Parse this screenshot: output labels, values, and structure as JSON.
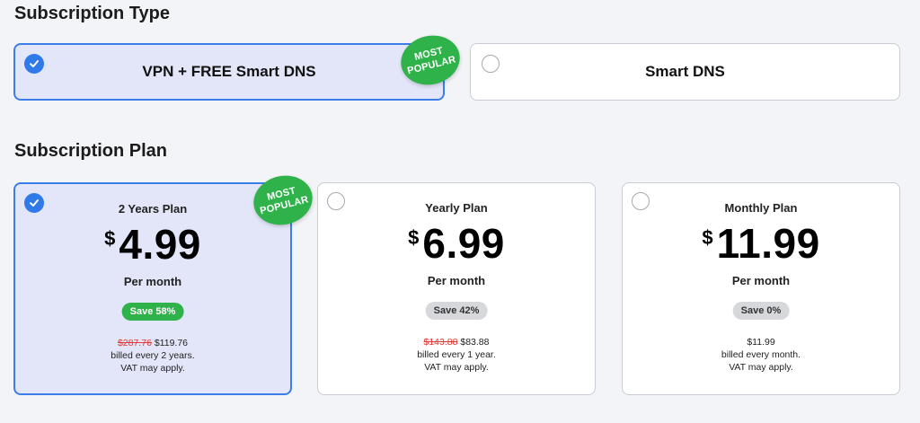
{
  "subscription_type": {
    "title": "Subscription Type",
    "options": [
      {
        "label": "VPN + FREE Smart DNS",
        "selected": true
      },
      {
        "label": "Smart DNS",
        "selected": false
      }
    ],
    "badge": {
      "line1": "MOST",
      "line2": "POPULAR"
    }
  },
  "subscription_plan": {
    "title": "Subscription Plan",
    "badge": {
      "line1": "MOST",
      "line2": "POPULAR"
    },
    "plans": [
      {
        "name": "2 Years Plan",
        "currency": "$",
        "price": "4.99",
        "per": "Per month",
        "save": "Save 58%",
        "old_price": "$287.76",
        "total": "$119.76",
        "billed": "billed every 2 years.",
        "vat": "VAT may apply.",
        "selected": true
      },
      {
        "name": "Yearly Plan",
        "currency": "$",
        "price": "6.99",
        "per": "Per month",
        "save": "Save 42%",
        "old_price": "$143.88",
        "total": "$83.88",
        "billed": "billed every 1 year.",
        "vat": "VAT may apply.",
        "selected": false
      },
      {
        "name": "Monthly Plan",
        "currency": "$",
        "price": "11.99",
        "per": "Per month",
        "save": "Save 0%",
        "old_price": "",
        "total": "$11.99",
        "billed": "billed every month.",
        "vat": "VAT may apply.",
        "selected": false
      }
    ]
  },
  "colors": {
    "accent": "#3b7de9",
    "selected_bg": "#e2e6f8",
    "badge_green": "#2fb24a",
    "strike_red": "#e53935"
  }
}
